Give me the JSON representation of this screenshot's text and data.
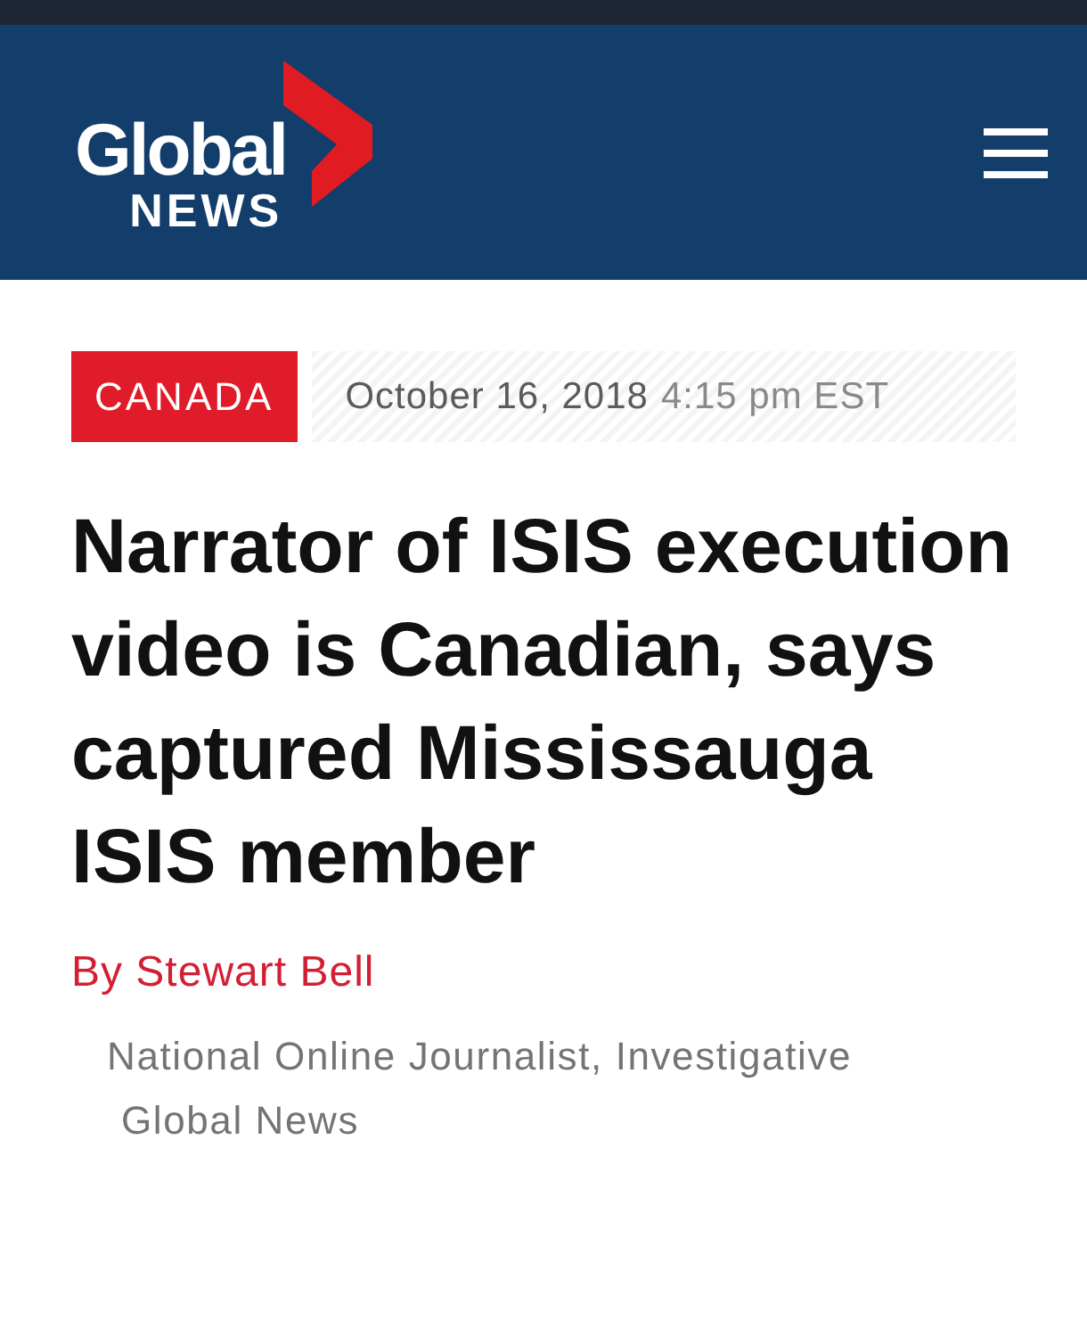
{
  "header": {
    "logo": {
      "line_1": "Global",
      "line_2": "NEWS"
    }
  },
  "article": {
    "category": "CANADA",
    "date": "October 16, 2018",
    "time": "4:15 pm EST",
    "headline": "Narrator of ISIS execution video is Canadian, says captured Mississauga ISIS member",
    "byline": "By Stewart Bell",
    "author_title": "National Online Journalist, Investigative",
    "author_org": "Global News"
  }
}
